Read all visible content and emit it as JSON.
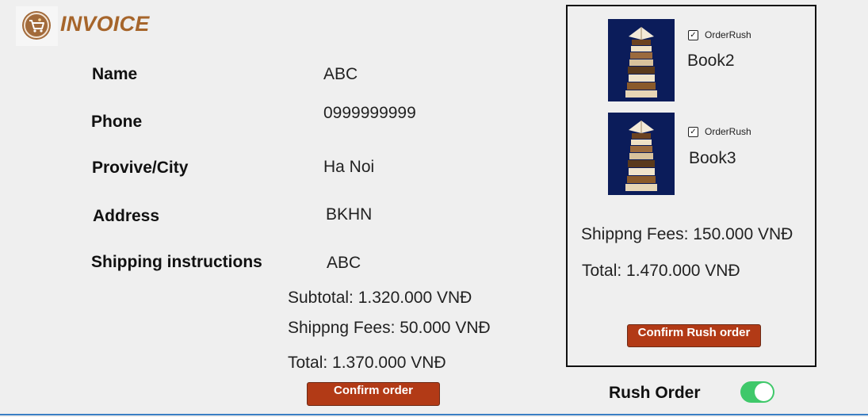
{
  "header": {
    "title": "INVOICE",
    "logo_icon": "cart-icon",
    "accent_color": "#a6652b"
  },
  "form": {
    "name_label": "Name",
    "name_value": "ABC",
    "phone_label": "Phone",
    "phone_value": "0999999999",
    "city_label": "Provive/City",
    "city_value": "Ha Noi",
    "address_label": "Address",
    "address_value": "BKHN",
    "shipping_label": "Shipping instructions",
    "shipping_value": "ABC"
  },
  "summary": {
    "subtotal": "Subtotal: 1.320.000 VNĐ",
    "shipping_fees": "Shippng Fees: 50.000 VNĐ",
    "total": "Total: 1.370.000 VNĐ",
    "confirm_label": "Confirm order"
  },
  "rush_panel": {
    "items": [
      {
        "name": "Book2",
        "rush_label": "OrderRush",
        "checked": true
      },
      {
        "name": "Book3",
        "rush_label": "OrderRush",
        "checked": true
      }
    ],
    "shipping_fees": "Shippng Fees: 150.000 VNĐ",
    "total": "Total: 1.470.000 VNĐ",
    "confirm_label": "Confirm Rush order"
  },
  "rush_toggle": {
    "label": "Rush Order",
    "on": true,
    "on_color": "#3fc86a"
  },
  "colors": {
    "button": "#b23a16",
    "background": "#efefef"
  }
}
